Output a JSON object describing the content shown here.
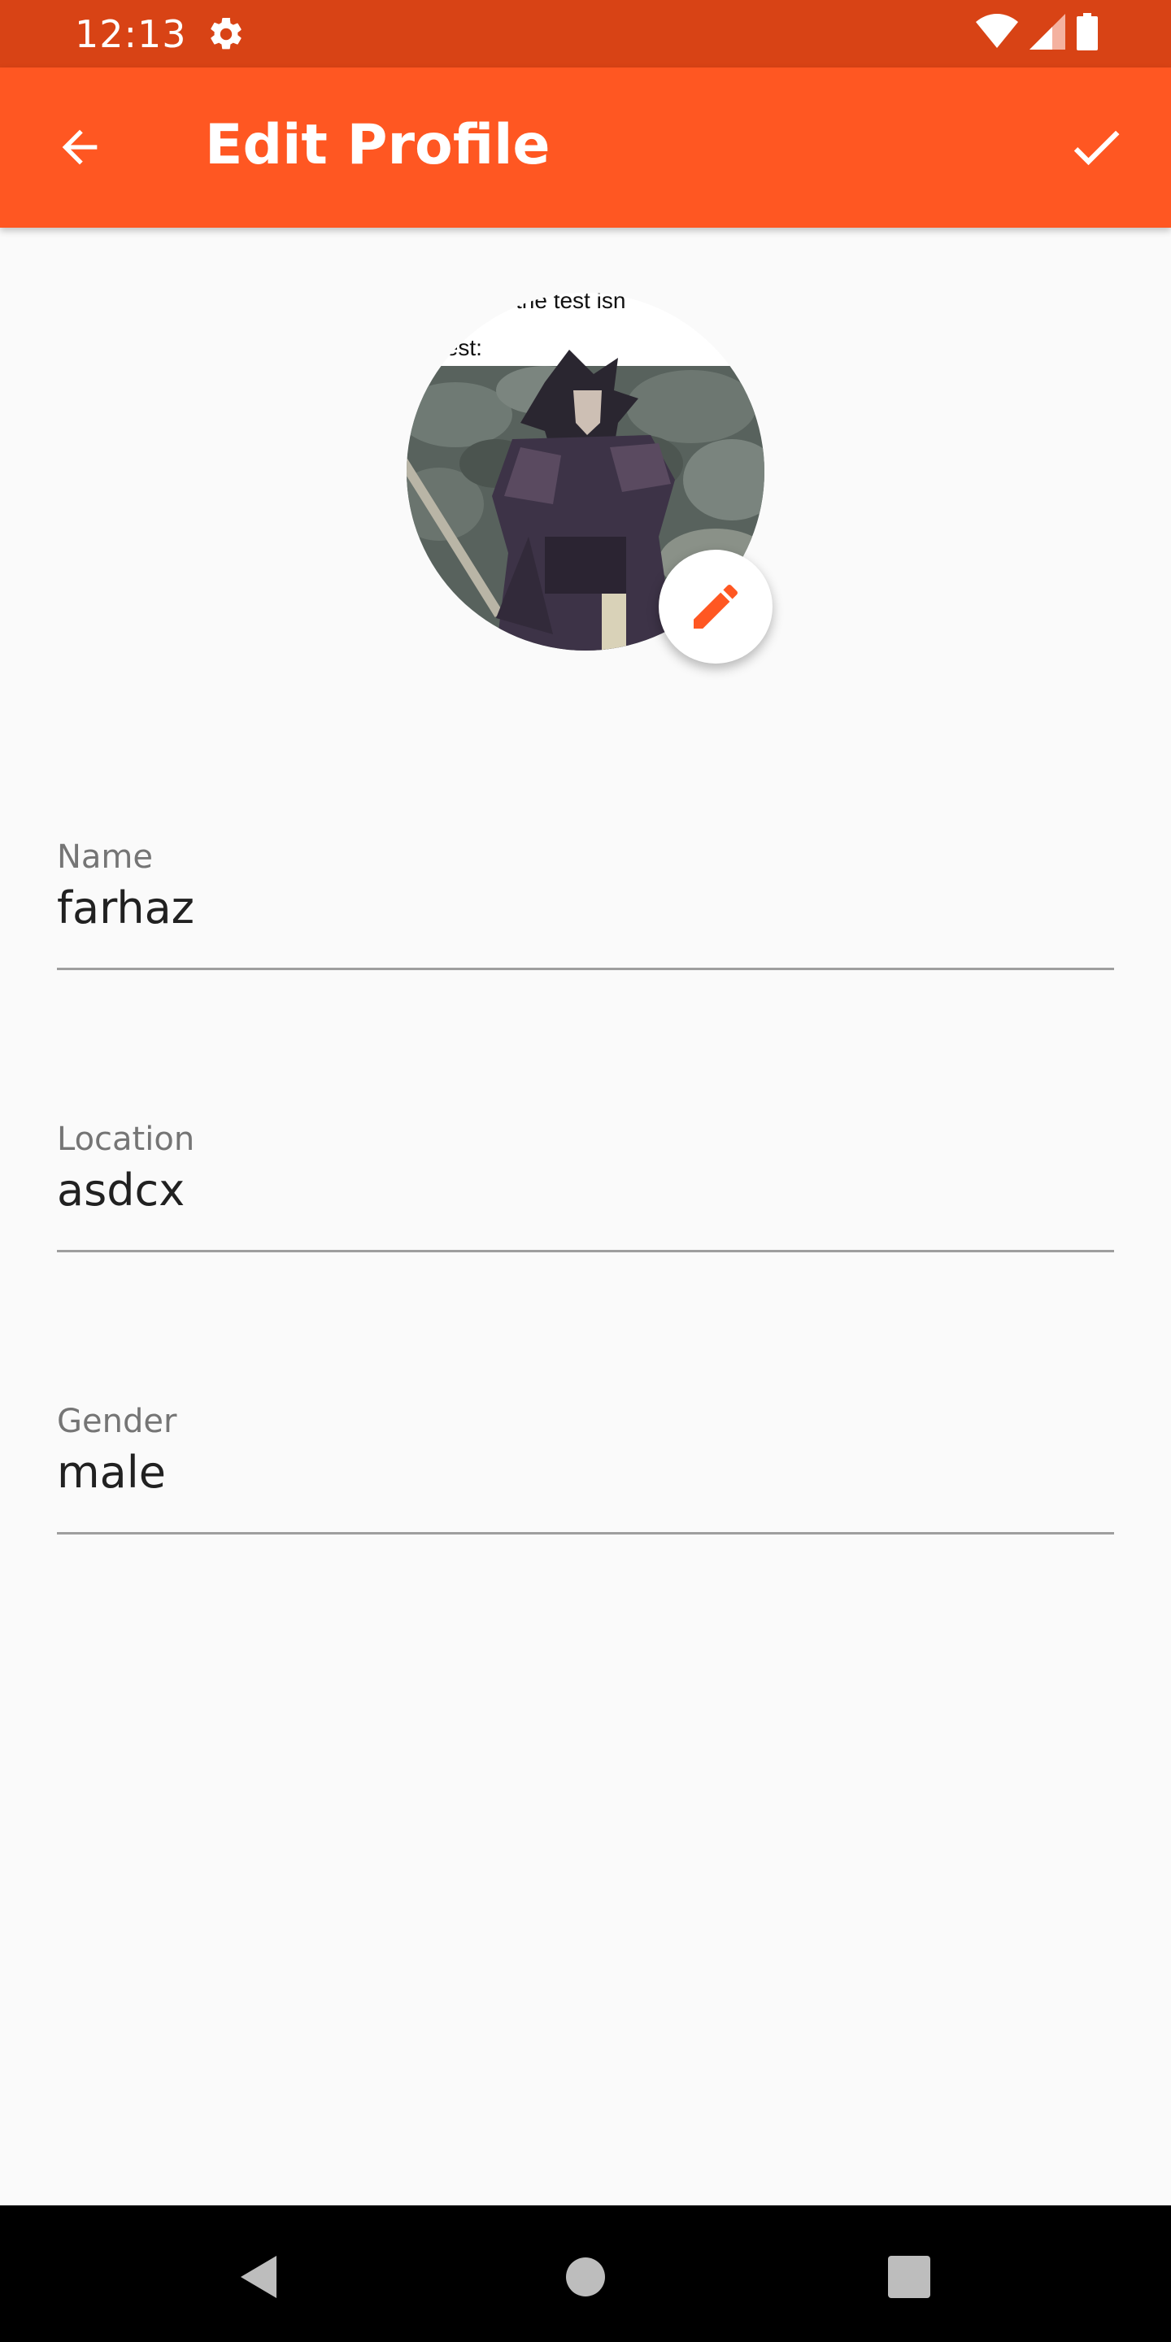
{
  "status_bar": {
    "time": "12:13",
    "icons": [
      "settings-gear-icon",
      "wifi-icon",
      "cell-signal-icon",
      "battery-icon"
    ],
    "background": "#d84315"
  },
  "app_bar": {
    "title": "Edit Profile",
    "back_icon": "arrow-back-icon",
    "save_icon": "check-icon",
    "background": "#ff5722"
  },
  "avatar": {
    "overlay_text_line1": "the test isn",
    "overlay_text_line2": "test:",
    "edit_icon": "pencil-icon",
    "accent": "#ff5722"
  },
  "fields": {
    "name": {
      "label": "Name",
      "value": "farhaz"
    },
    "location": {
      "label": "Location",
      "value": "asdcx"
    },
    "gender": {
      "label": "Gender",
      "value": "male"
    }
  },
  "nav_bar": {
    "buttons": [
      "back-triangle-icon",
      "home-circle-icon",
      "recents-square-icon"
    ]
  }
}
